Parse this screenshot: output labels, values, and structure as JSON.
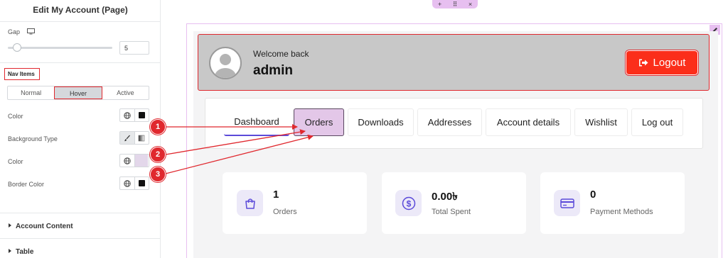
{
  "panel": {
    "title": "Edit My Account (Page)",
    "gap_label": "Gap",
    "gap_value": "5",
    "gap_slider_level": 0.05,
    "nav_items_label": "Nav Items",
    "state_tabs": [
      "Normal",
      "Hover",
      "Active"
    ],
    "selected_state": "Hover",
    "color_label": "Color",
    "background_type_label": "Background Type",
    "bg_color_label": "Color",
    "border_color_label": "Border Color",
    "account_content_label": "Account Content",
    "table_label": "Table"
  },
  "canvas": {
    "toolbar": {
      "add": "+",
      "move": "⠿",
      "close": "×"
    },
    "welcome": {
      "greeting": "Welcome back",
      "username": "admin"
    },
    "logout_label": "Logout",
    "nav": [
      "Dashboard",
      "Orders",
      "Downloads",
      "Addresses",
      "Account details",
      "Wishlist",
      "Log out"
    ],
    "stats": [
      {
        "value": "1",
        "label": "Orders",
        "icon": "shopping-bag-icon"
      },
      {
        "value": "0.00৳",
        "label": "Total Spent",
        "icon": "dollar-circle-icon"
      },
      {
        "value": "0",
        "label": "Payment Methods",
        "icon": "credit-card-icon"
      }
    ]
  },
  "annotations": [
    "1",
    "2",
    "3"
  ],
  "colors": {
    "highlight_red": "#e0282e",
    "logout_red": "#fb2e1a",
    "hover_bg": "#e3c7e8",
    "active_underline": "#5b4ad9",
    "icon_purple": "#5b4ad9"
  }
}
